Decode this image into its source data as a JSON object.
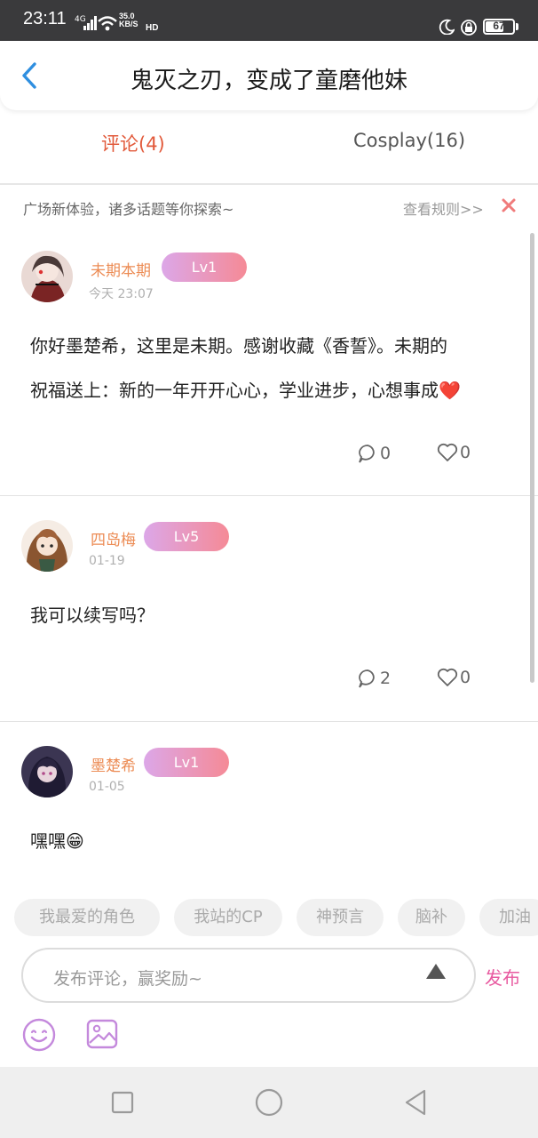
{
  "status_bar": {
    "time": "23:11",
    "network": "4G",
    "speed_value": "35.0",
    "speed_unit": "KB/S",
    "hd": "HD",
    "battery": "67",
    "battery_level": 0.67
  },
  "header": {
    "title": "鬼灭之刃，变成了童磨他妹",
    "back_icon": "chevron-left-icon",
    "accent_color": "#2f8fe0"
  },
  "tabs": [
    {
      "label": "评论(4)",
      "active": true
    },
    {
      "label": "Cosplay(16)",
      "active": false
    }
  ],
  "notice": {
    "text": "广场新体验，诸多话题等你探索~",
    "rules_link": "查看规则>>",
    "close_icon": "close-icon"
  },
  "comments": [
    {
      "username": "未期本期",
      "level": "Lv1",
      "time": "今天 23:07",
      "text_line1": "你好墨楚希，这里是未期。感谢收藏《香誓》。未期的",
      "text_line2": "祝福送上：新的一年开开心心，学业进步，心想事成❤️",
      "replies": "0",
      "likes": "0"
    },
    {
      "username": "四岛梅",
      "level": "Lv5",
      "time": "01-19",
      "text_line1": "我可以续写吗？",
      "replies": "2",
      "likes": "0"
    },
    {
      "username": "墨楚希",
      "level": "Lv1",
      "time": "01-05",
      "text_line1": "嘿嘿😁"
    }
  ],
  "topic_chips": [
    "我最爱的角色",
    "我站的CP",
    "神预言",
    "脑补",
    "加油"
  ],
  "composer": {
    "placeholder": "发布评论，赢奖励~",
    "publish_label": "发布",
    "emoji_icon": "smiley-icon",
    "image_icon": "image-icon"
  },
  "navbar": {
    "recent_icon": "square-icon",
    "home_icon": "circle-icon",
    "back_icon": "triangle-back-icon"
  }
}
